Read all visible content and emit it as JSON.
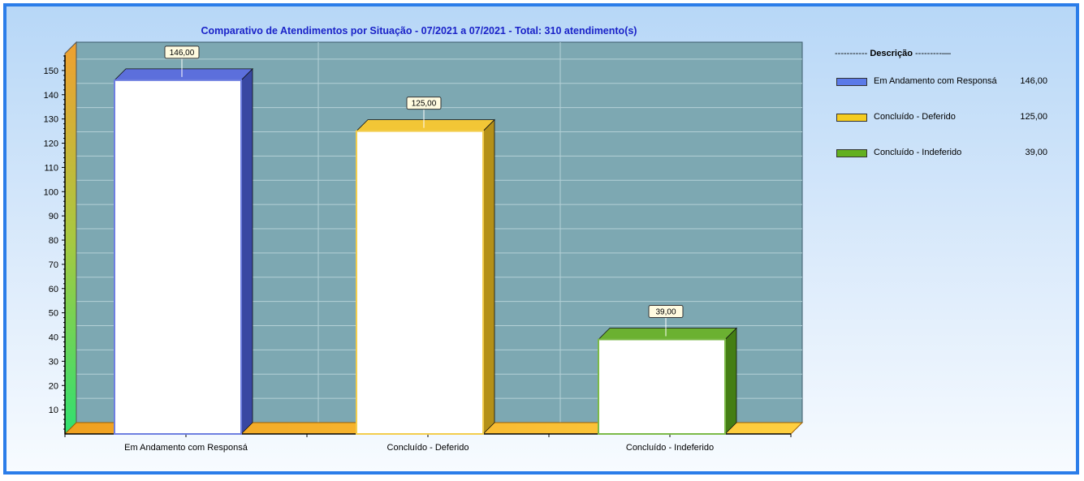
{
  "chart_data": {
    "type": "bar",
    "title": "Comparativo  de  Atendimentos  por  Situação  -  07/2021  a  07/2021  -  Total:  310  atendimento(s)",
    "categories": [
      "Em Andamento com Responsá",
      "Concluído - Deferido",
      "Concluído - Indeferido"
    ],
    "values": [
      146,
      125,
      39
    ],
    "value_labels": [
      "146,00",
      "125,00",
      "39,00"
    ],
    "colors": [
      "#4a5fd8",
      "#f0c020",
      "#5aa81a"
    ],
    "y_ticks": [
      "10",
      "20",
      "30",
      "40",
      "50",
      "60",
      "70",
      "80",
      "90",
      "100",
      "110",
      "120",
      "130",
      "140",
      "150"
    ],
    "ylim": [
      0,
      157
    ],
    "grid": true,
    "legend_position": "right"
  },
  "legend": {
    "header_prefix": "----------- ",
    "header_title": "Descrição",
    "header_suffix": " ---------—",
    "items": [
      {
        "label": "Em Andamento com Responsá",
        "value": "146,00"
      },
      {
        "label": "Concluído - Deferido",
        "value": "125,00"
      },
      {
        "label": "Concluído - Indeferido",
        "value": "39,00"
      }
    ]
  }
}
